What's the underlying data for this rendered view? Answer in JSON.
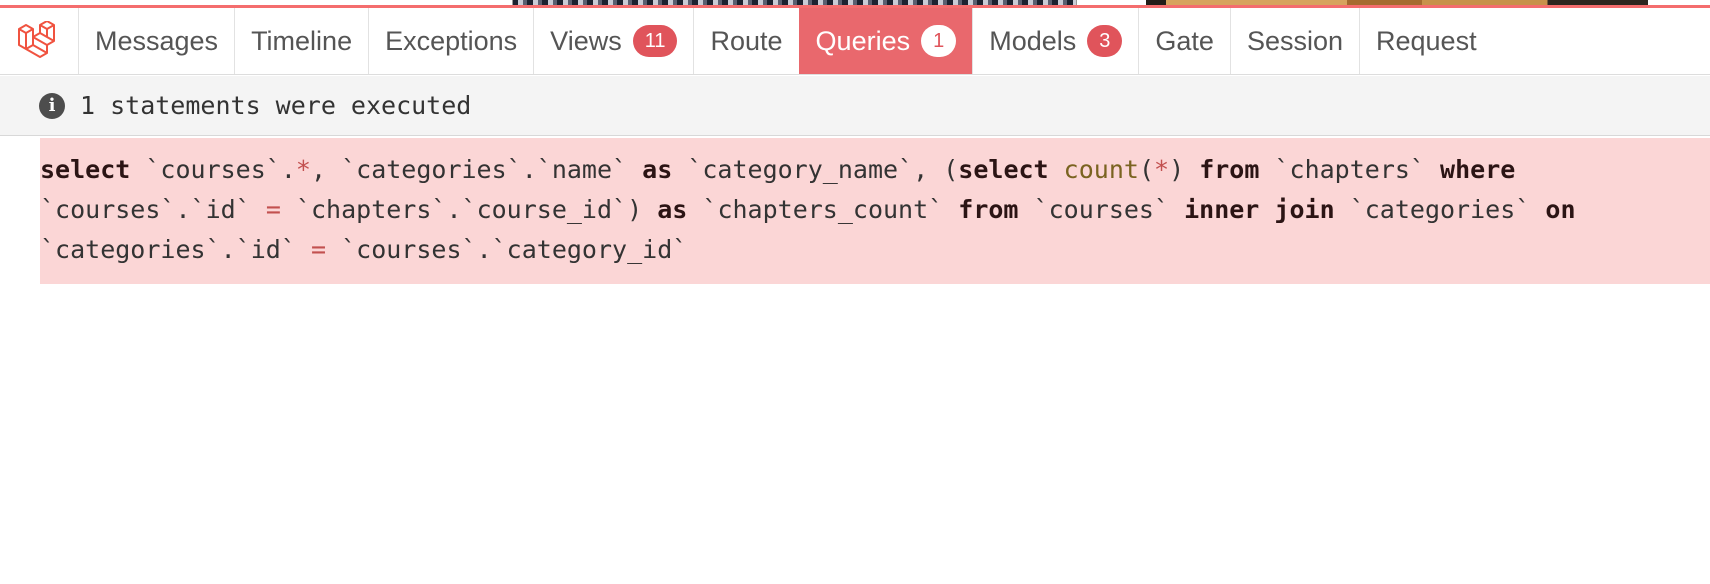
{
  "toolbar": {
    "logo_icon": "laravel-logo",
    "tabs": [
      {
        "label": "Messages"
      },
      {
        "label": "Timeline"
      },
      {
        "label": "Exceptions"
      },
      {
        "label": "Views",
        "badge": "11"
      },
      {
        "label": "Route"
      },
      {
        "label": "Queries",
        "badge": "1",
        "active": true
      },
      {
        "label": "Models",
        "badge": "3"
      },
      {
        "label": "Gate"
      },
      {
        "label": "Session"
      },
      {
        "label": "Request"
      }
    ]
  },
  "status": {
    "icon": "info-icon",
    "text": "1 statements were executed"
  },
  "query": {
    "sql": "select `courses`.*, `categories`.`name` as `category_name`, (select count(*) from `chapters` where `courses`.`id` = `chapters`.`course_id`) as `chapters_count` from `courses` inner join `categories` on `categories`.`id` = `courses`.`category_id`"
  },
  "colors": {
    "accent": "#e9686d",
    "badge": "#e0545b",
    "query_background": "#fbd6d6"
  }
}
